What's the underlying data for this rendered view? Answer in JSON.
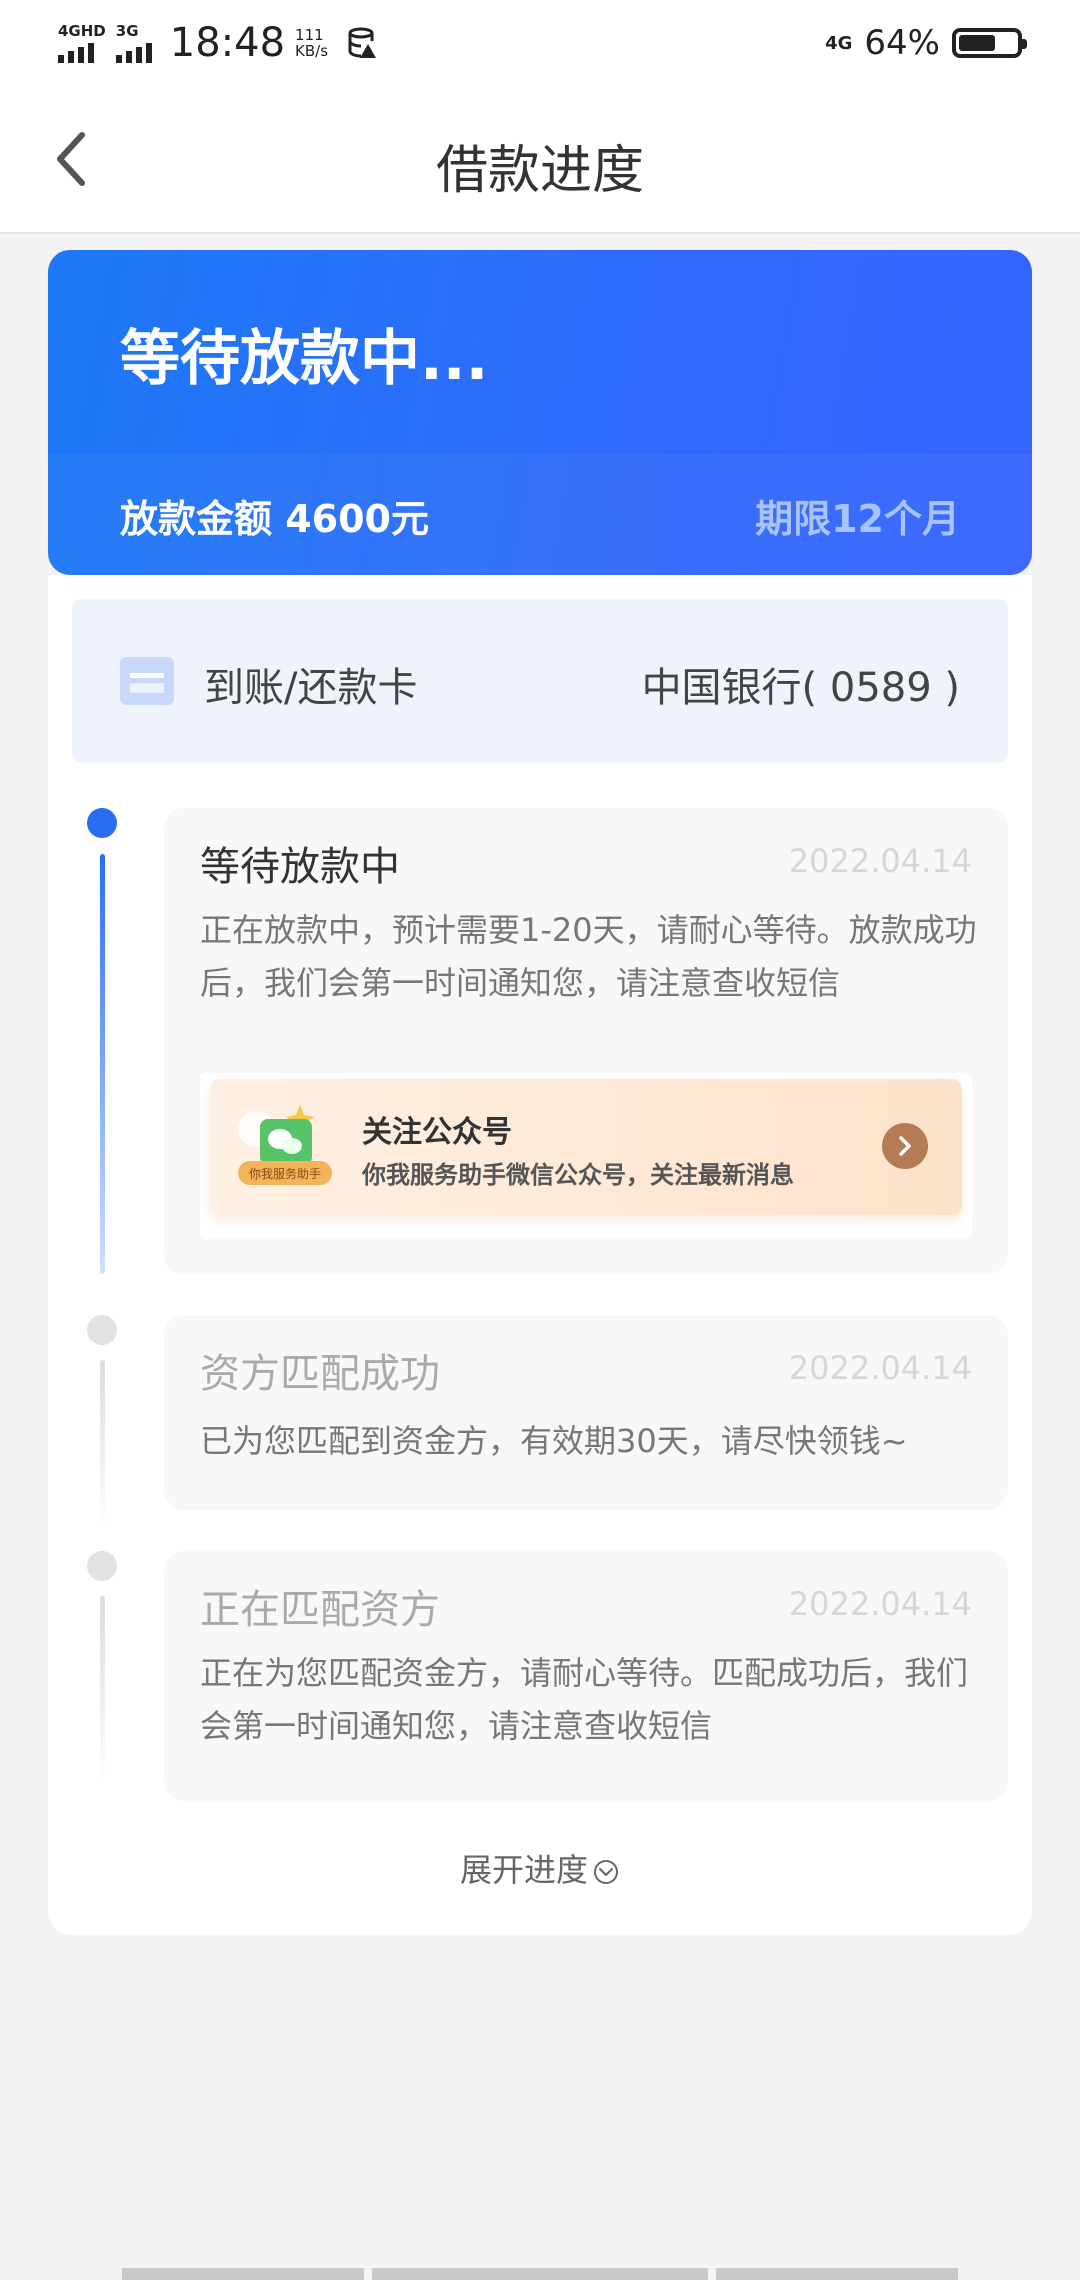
{
  "status_bar": {
    "signal1_label": "4GHD",
    "signal2_label": "3G",
    "time": "18:48",
    "speed_value": "111",
    "speed_unit": "KB/s",
    "network": "4G",
    "battery_percent": "64%",
    "battery_level": 0.64
  },
  "nav": {
    "title": "借款进度"
  },
  "hero": {
    "status": "等待放款中...",
    "amount": "放款金额 4600元",
    "term": "期限12个月"
  },
  "bank": {
    "label": "到账/还款卡",
    "value": "中国银行( 0589 )"
  },
  "steps": [
    {
      "title": "等待放款中",
      "date": "2022.04.14",
      "desc": "正在放款中，预计需要1-20天，请耐心等待。放款成功后，我们会第一时间通知您，请注意查收短信",
      "active": true
    },
    {
      "title": "资方匹配成功",
      "date": "2022.04.14",
      "desc": "已为您匹配到资金方，有效期30天，请尽快领钱~",
      "active": false
    },
    {
      "title": "正在匹配资方",
      "date": "2022.04.14",
      "desc": "正在为您匹配资金方，请耐心等待。匹配成功后，我们会第一时间通知您，请注意查收短信",
      "active": false
    }
  ],
  "promo": {
    "title": "关注公众号",
    "subtitle": "你我服务助手微信公众号，关注最新消息",
    "badge": "你我服务助手"
  },
  "expand_label": "展开进度",
  "colors": {
    "accent": "#2f6cfb",
    "active_dot": "#2a6cf2",
    "inactive_dot": "#e2e2e2"
  }
}
